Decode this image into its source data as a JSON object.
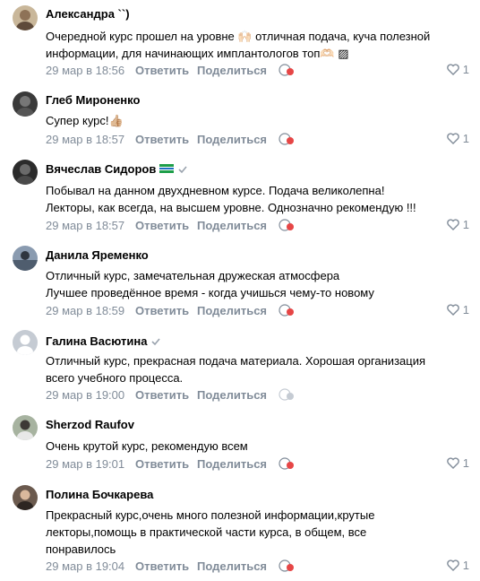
{
  "comments": [
    {
      "author": "Александра ``)",
      "lines": [
        "Очередной курс прошел на уровне 🙌🏻 отличная подача, куча полезной",
        "информации, для начинающих имплантологов топ🫶🏻 ▨"
      ],
      "date": "29 мар в 18:56",
      "reply": "Ответить",
      "share": "Поделиться",
      "likes": "1",
      "verified": false,
      "avatar_color": "#c9b79a"
    },
    {
      "author": "Глеб Мироненко",
      "lines": [
        "Супер курс!👍🏼"
      ],
      "date": "29 мар в 18:57",
      "reply": "Ответить",
      "share": "Поделиться",
      "likes": "1",
      "verified": false,
      "avatar_color": "#3a3a3a"
    },
    {
      "author": "Вячеслав Сидоров",
      "lines": [
        "Побывал на данном двухдневном курсе. Подача великолепна!",
        "Лекторы, как всегда, на высшем уровне. Однозначно рекомендую !!!"
      ],
      "date": "29 мар в 18:57",
      "reply": "Ответить",
      "share": "Поделиться",
      "likes": "1",
      "verified": true,
      "avatar_color": "#2b2b2b"
    },
    {
      "author": "Данила Яременко",
      "lines": [
        "Отличный курс, замечательная дружеская атмосфера",
        "Лучшее проведённое время - когда учишься чему-то новому"
      ],
      "date": "29 мар в 18:59",
      "reply": "Ответить",
      "share": "Поделиться",
      "likes": "1",
      "verified": false,
      "avatar_color": "#8a9bb0"
    },
    {
      "author": "Галина Васютина",
      "lines": [
        "Отличный курс, прекрасная подача материала. Хорошая организация",
        "всего учебного процесса."
      ],
      "date": "29 мар в 19:00",
      "reply": "Ответить",
      "share": "Поделиться",
      "likes": "",
      "verified": true,
      "avatar_color": "#c5cbd3"
    },
    {
      "author": "Sherzod Raufov",
      "lines": [
        "Очень крутой курс, рекомендую всем"
      ],
      "date": "29 мар в 19:01",
      "reply": "Ответить",
      "share": "Поделиться",
      "likes": "1",
      "verified": false,
      "avatar_color": "#a7b3a0"
    },
    {
      "author": "Полина Бочкарева",
      "lines": [
        "Прекрасный курс,очень много полезной информации,крутые",
        "лекторы,помощь в практической части курса, в общем, все",
        "понравилось"
      ],
      "date": "29 мар в 19:04",
      "reply": "Ответить",
      "share": "Поделиться",
      "likes": "1",
      "verified": false,
      "avatar_color": "#6b5a4e"
    }
  ],
  "colors": {
    "meta": "#818c99",
    "reaction": "#e64646"
  }
}
